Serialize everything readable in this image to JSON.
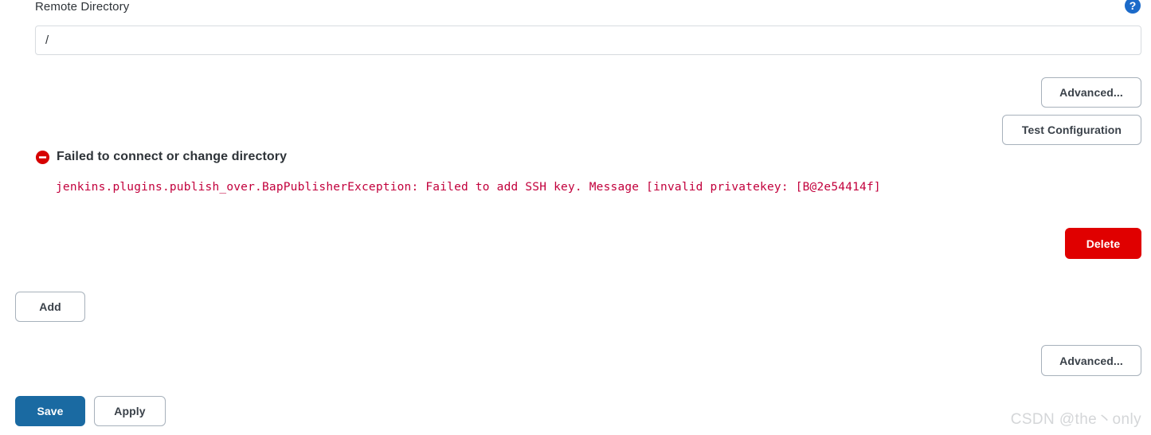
{
  "form": {
    "remote_directory": {
      "label": "Remote Directory",
      "value": "/",
      "placeholder": "",
      "help_icon": "help-question-icon"
    }
  },
  "buttons": {
    "advanced_top": "Advanced...",
    "test_configuration": "Test Configuration",
    "delete": "Delete",
    "add": "Add",
    "advanced_bottom": "Advanced...",
    "save": "Save",
    "apply": "Apply"
  },
  "error": {
    "icon": "error-denied-icon",
    "title": "Failed to connect or change directory",
    "detail": "jenkins.plugins.publish_over.BapPublisherException: Failed to add SSH key. Message [invalid privatekey: [B@2e54414f]"
  },
  "watermark": {
    "text": "CSDN @the丶only"
  },
  "colors": {
    "primary": "#1a6aa2",
    "danger": "#e00000",
    "error_text": "#c2003c",
    "border": "#a7b1bb",
    "input_border": "#d8dce0",
    "help_blue": "#1b6ac9",
    "text": "#2e3338",
    "watermark": "#d4d6d8"
  }
}
